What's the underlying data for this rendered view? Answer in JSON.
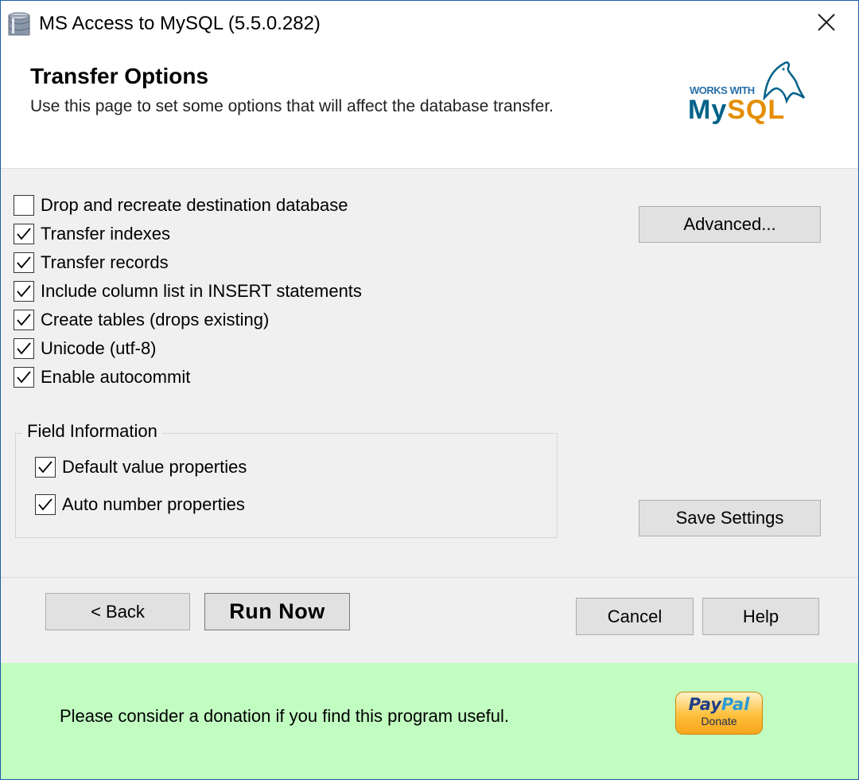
{
  "window": {
    "title": "MS Access to MySQL (5.5.0.282)"
  },
  "header": {
    "title": "Transfer Options",
    "subtitle": "Use this page to set some options that will affect the database transfer.",
    "logo": {
      "works_with": "WORKS WITH",
      "word_my": "My",
      "word_sql": "SQL"
    }
  },
  "options": [
    {
      "label": "Drop and recreate destination database",
      "checked": false
    },
    {
      "label": "Transfer indexes",
      "checked": true
    },
    {
      "label": "Transfer records",
      "checked": true
    },
    {
      "label": "Include column list in INSERT statements",
      "checked": true
    },
    {
      "label": "Create tables (drops existing)",
      "checked": true
    },
    {
      "label": "Unicode (utf-8)",
      "checked": true
    },
    {
      "label": "Enable autocommit",
      "checked": true
    }
  ],
  "field_info": {
    "title": "Field Information",
    "options": [
      {
        "label": "Default value properties",
        "checked": true
      },
      {
        "label": "Auto number properties",
        "checked": true
      }
    ]
  },
  "buttons": {
    "advanced": "Advanced...",
    "save_settings": "Save Settings",
    "back": "< Back",
    "run_now": "Run Now",
    "cancel": "Cancel",
    "help": "Help"
  },
  "donate": {
    "text": "Please consider a donation if you find this program useful.",
    "paypal_pay": "Pay",
    "paypal_pal": "Pal",
    "paypal_sub": "Donate"
  },
  "icons": [
    "database-icon",
    "close-icon",
    "mysql-dolphin-icon",
    "checkmark-icon"
  ]
}
